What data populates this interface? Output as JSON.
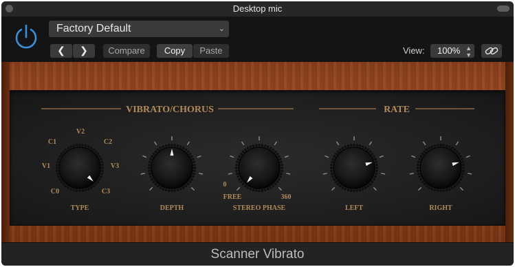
{
  "window": {
    "title": "Desktop mic"
  },
  "header": {
    "preset_name": "Factory Default",
    "compare_label": "Compare",
    "copy_label": "Copy",
    "paste_label": "Paste",
    "view_label": "View:",
    "zoom_value": "100%",
    "power_on": true
  },
  "plugin": {
    "name": "Scanner Vibrato",
    "sections": {
      "vibrato_chorus": "VIBRATO/CHORUS",
      "rate": "RATE"
    },
    "knobs": {
      "type": {
        "label": "TYPE",
        "value": "C3",
        "scale": [
          "C0",
          "V1",
          "C1",
          "V2",
          "C2",
          "V3",
          "C3"
        ]
      },
      "depth": {
        "label": "DEPTH",
        "value_fraction": 0.5
      },
      "stereo_phase": {
        "label": "STEREO PHASE",
        "min_label": "0",
        "free_label": "FREE",
        "max_label": "360",
        "value": "FREE"
      },
      "left": {
        "label": "LEFT",
        "value_fraction": 0.77
      },
      "right": {
        "label": "RIGHT",
        "value_fraction": 0.77
      }
    }
  },
  "colors": {
    "accent_blue": "#3b8fd6",
    "label_gold": "#b08a58",
    "wood": "#9a4820"
  }
}
